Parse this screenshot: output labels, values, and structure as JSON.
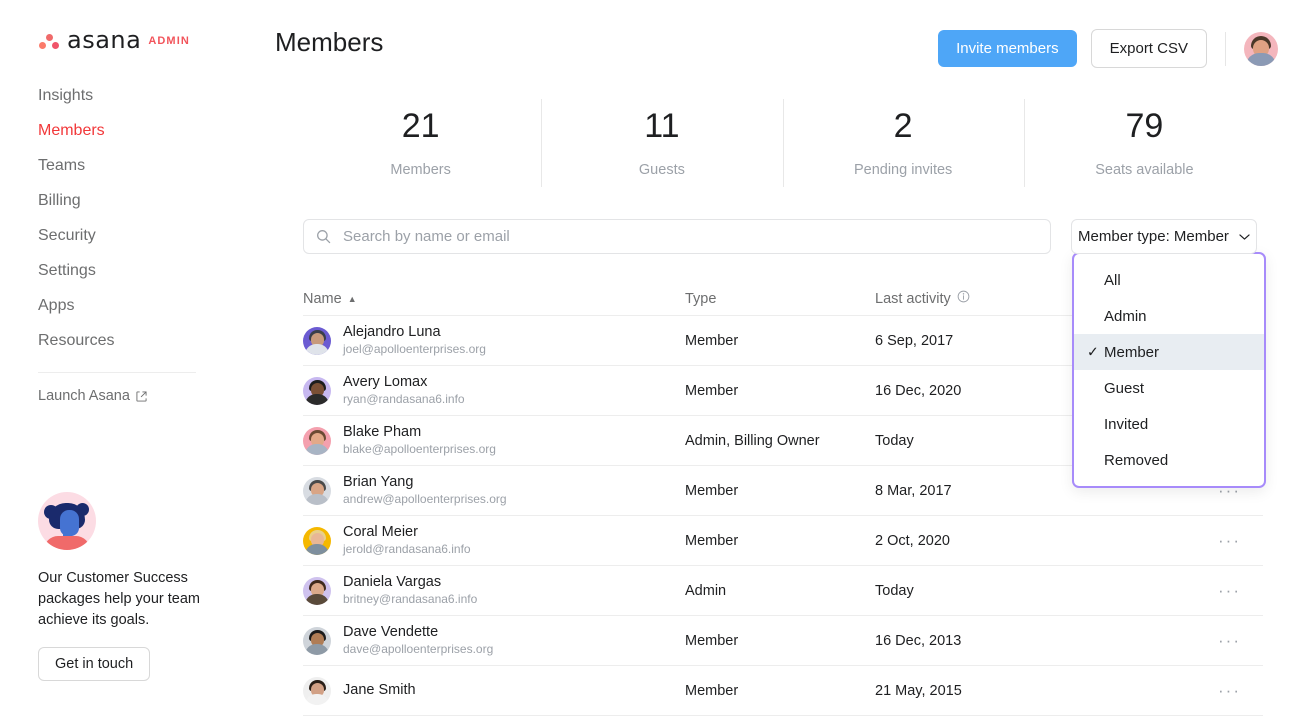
{
  "brand": {
    "word": "asana",
    "suffix": "ADMIN"
  },
  "header": {
    "title": "Members",
    "invite_label": "Invite members",
    "export_label": "Export CSV"
  },
  "sidebar": {
    "items": [
      {
        "label": "Insights"
      },
      {
        "label": "Members"
      },
      {
        "label": "Teams"
      },
      {
        "label": "Billing"
      },
      {
        "label": "Security"
      },
      {
        "label": "Settings"
      },
      {
        "label": "Apps"
      },
      {
        "label": "Resources"
      }
    ],
    "launch_label": "Launch Asana",
    "promo": {
      "text": "Our Customer Success packages help your team achieve its goals.",
      "button_label": "Get in touch"
    }
  },
  "stats": [
    {
      "value": "21",
      "label": "Members"
    },
    {
      "value": "11",
      "label": "Guests"
    },
    {
      "value": "2",
      "label": "Pending invites"
    },
    {
      "value": "79",
      "label": "Seats available"
    }
  ],
  "search": {
    "placeholder": "Search by name or email",
    "value": ""
  },
  "filter": {
    "button_label": "Member type: Member",
    "options": [
      {
        "label": "All",
        "selected": false
      },
      {
        "label": "Admin",
        "selected": false
      },
      {
        "label": "Member",
        "selected": true
      },
      {
        "label": "Guest",
        "selected": false
      },
      {
        "label": "Invited",
        "selected": false
      },
      {
        "label": "Removed",
        "selected": false
      }
    ],
    "check_glyph": "✓"
  },
  "table": {
    "columns": {
      "name": "Name",
      "type": "Type",
      "activity": "Last activity"
    },
    "sort_glyph": "▲",
    "menu_glyph": "···",
    "rows": [
      {
        "name": "Alejandro Luna",
        "email": "joel@apolloenterprises.org",
        "type": "Member",
        "activity": "6 Sep, 2017",
        "menu": false,
        "av_bg": "#6b5bd2",
        "av_hair": "#3a3f4a",
        "av_face": "#c89a7c",
        "av_body": "#dfe3ea"
      },
      {
        "name": "Avery Lomax",
        "email": "ryan@randasana6.info",
        "type": "Member",
        "activity": "16 Dec, 2020",
        "menu": false,
        "av_bg": "#c7b8f0",
        "av_hair": "#1d1d1d",
        "av_face": "#7a4f35",
        "av_body": "#2b2b2b"
      },
      {
        "name": "Blake Pham",
        "email": "blake@apolloenterprises.org",
        "type": "Admin, Billing Owner",
        "activity": "Today",
        "menu": false,
        "av_bg": "#f4a0ae",
        "av_hair": "#6b4a33",
        "av_face": "#e3a989",
        "av_body": "#a8b4c4"
      },
      {
        "name": "Brian Yang",
        "email": "andrew@apolloenterprises.org",
        "type": "Member",
        "activity": "8 Mar, 2017",
        "menu": true,
        "av_bg": "#d8dce2",
        "av_hair": "#4a4a4a",
        "av_face": "#d9a586",
        "av_body": "#b9bfc8"
      },
      {
        "name": "Coral Meier",
        "email": "jerold@randasana6.info",
        "type": "Member",
        "activity": "2 Oct, 2020",
        "menu": true,
        "av_bg": "#f5b800",
        "av_hair": "#e8d08a",
        "av_face": "#e8b795",
        "av_body": "#7e8f9e"
      },
      {
        "name": "Daniela Vargas",
        "email": "britney@randasana6.info",
        "type": "Admin",
        "activity": "Today",
        "menu": true,
        "av_bg": "#cfc2ee",
        "av_hair": "#3f2a1d",
        "av_face": "#dba98a",
        "av_body": "#5a4a3a"
      },
      {
        "name": "Dave Vendette",
        "email": "dave@apolloenterprises.org",
        "type": "Member",
        "activity": "16 Dec, 2013",
        "menu": true,
        "av_bg": "#cfd4da",
        "av_hair": "#1c1c1c",
        "av_face": "#b07d56",
        "av_body": "#8e9aa6"
      },
      {
        "name": "Jane Smith",
        "email": "",
        "type": "Member",
        "activity": "21 May, 2015",
        "menu": true,
        "av_bg": "#efefef",
        "av_hair": "#2a1f18",
        "av_face": "#d2a186",
        "av_body": "#f2f2f2"
      }
    ]
  },
  "colors": {
    "accent_red": "#f2383a",
    "primary_blue": "#4ea6f7",
    "dropdown_border": "#a78bfa",
    "text": "#1e1f21",
    "muted": "#9ca1a8"
  }
}
